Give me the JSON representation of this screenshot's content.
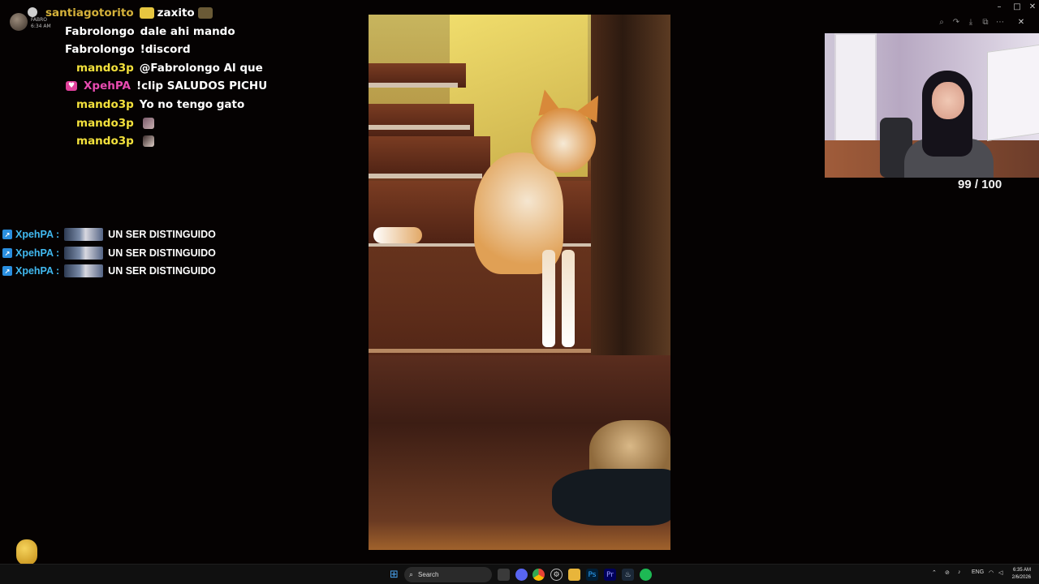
{
  "chat": {
    "header": {
      "user": "santiagotorito",
      "user_color": "#d4b13a",
      "message": "zaxito",
      "meta_name": "FABRO",
      "meta_time": "6:34 AM"
    },
    "messages": [
      {
        "user": "Fabrolongo",
        "color": "#ffffff",
        "text": "dale ahi mando"
      },
      {
        "user": "Fabrolongo",
        "color": "#ffffff",
        "text": "!discord"
      },
      {
        "user": "mando3p",
        "color": "#f3e13c",
        "text": "@Fabrolongo Al que"
      },
      {
        "user": "XpehPA",
        "color": "#e84bb0",
        "text": "!clip SALUDOS PICHU"
      },
      {
        "user": "mando3p",
        "color": "#f3e13c",
        "text": "Yo no tengo gato"
      },
      {
        "user": "mando3p",
        "color": "#f3e13c",
        "text": ""
      },
      {
        "user": "mando3p",
        "color": "#f3e13c",
        "text": ""
      }
    ]
  },
  "chat2": {
    "messages": [
      {
        "user": "XpehPA :",
        "text": "UN SER DISTINGUIDO"
      },
      {
        "user": "XpehPA :",
        "text": "UN SER DISTINGUIDO"
      },
      {
        "user": "XpehPA :",
        "text": "UN SER DISTINGUIDO"
      }
    ]
  },
  "counter": "99 / 100",
  "taskbar": {
    "search_label": "Search",
    "language": "ENG",
    "time": "6:35 AM",
    "date": "2/6/2026"
  },
  "colors": {
    "background": "#050202",
    "kick_blue": "#41b9f0",
    "taskbar": "#101010"
  }
}
